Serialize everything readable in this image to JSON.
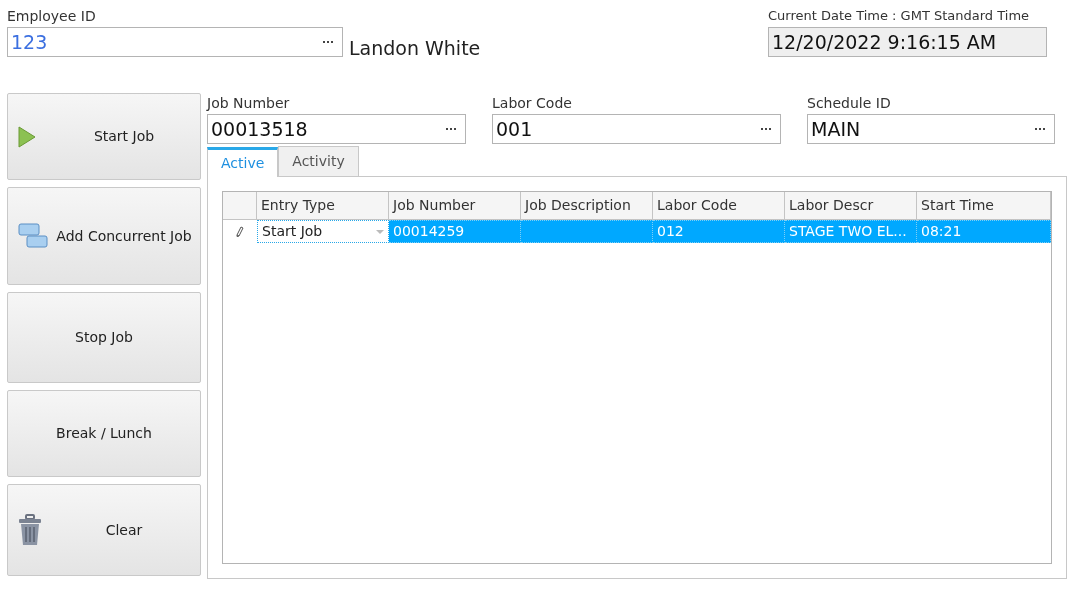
{
  "employee": {
    "label": "Employee ID",
    "value": "123",
    "name": "Landon White"
  },
  "clock": {
    "label": "Current Date Time : GMT Standard Time",
    "value": "12/20/2022 9:16:15 AM"
  },
  "actions": [
    {
      "label": "Start Job",
      "kind": "start"
    },
    {
      "label": "Add Concurrent Job",
      "kind": "concurrent"
    },
    {
      "label": "Stop Job",
      "kind": "plain"
    },
    {
      "label": "Break / Lunch",
      "kind": "plain"
    },
    {
      "label": "Clear",
      "kind": "clear"
    }
  ],
  "fields": [
    {
      "label": "Job Number",
      "value": "00013518"
    },
    {
      "label": "Labor Code",
      "value": "001"
    },
    {
      "label": "Schedule ID",
      "value": "MAIN"
    }
  ],
  "tabs": [
    {
      "label": "Active",
      "selected": true
    },
    {
      "label": "Activity",
      "selected": false
    }
  ],
  "table": {
    "columns": [
      "Entry Type",
      "Job Number",
      "Job Description",
      "Labor Code",
      "Labor Descr",
      "Start Time"
    ],
    "rows": [
      {
        "selected": true,
        "editing": true,
        "cells": [
          "Start Job",
          "00014259",
          "",
          "012",
          "STAGE TWO EL...",
          "08:21"
        ]
      }
    ]
  }
}
